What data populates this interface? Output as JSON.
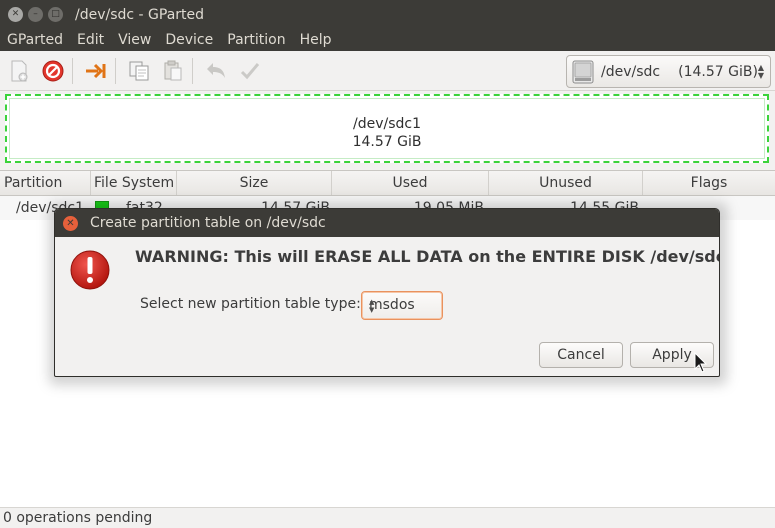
{
  "window": {
    "title": "/dev/sdc - GParted",
    "buttons": [
      "close",
      "minimize",
      "maximize"
    ]
  },
  "menu": {
    "items": [
      "GParted",
      "Edit",
      "View",
      "Device",
      "Partition",
      "Help"
    ]
  },
  "toolbar": {
    "buttons": [
      "new-icon",
      "delete-icon",
      "resize-move-icon",
      "copy-icon",
      "paste-icon",
      "undo-icon",
      "apply-icon"
    ],
    "device_selector": {
      "device": "/dev/sdc",
      "size": "(14.57 GiB)"
    }
  },
  "disk_map": {
    "partition_name": "/dev/sdc1",
    "partition_size": "14.57 GiB",
    "color": "#3bd33b"
  },
  "table": {
    "columns": [
      "Partition",
      "File System",
      "Size",
      "Used",
      "Unused",
      "Flags"
    ],
    "rows": [
      {
        "partition": "/dev/sdc1",
        "filesystem": "fat32",
        "size": "14.57 GiB",
        "used": "19.05 MiB",
        "unused": "14.55 GiB",
        "flags": ""
      }
    ],
    "fat32_color": "#18c918"
  },
  "dialog": {
    "title": "Create partition table on /dev/sdc",
    "warning": "WARNING:  This will ERASE ALL DATA on the ENTIRE DISK /dev/sdc",
    "type_label": "Select new partition table type:",
    "type_value": "msdos",
    "cancel_label": "Cancel",
    "apply_label": "Apply",
    "accent_color": "#e6603b"
  },
  "status": {
    "text": "0 operations pending"
  }
}
